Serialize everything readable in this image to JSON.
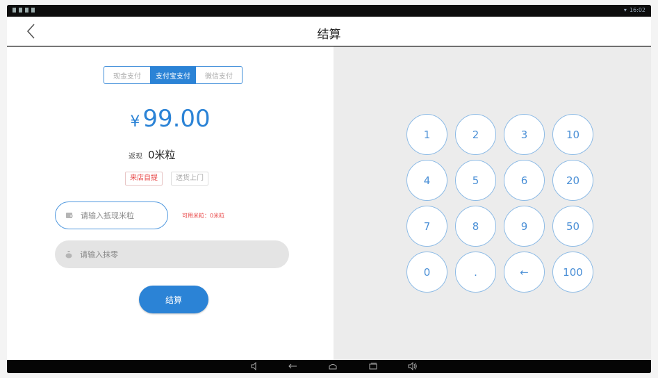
{
  "app": {
    "title": "结算"
  },
  "payment_tabs": [
    {
      "label": "现金支付",
      "active": false
    },
    {
      "label": "支付宝支付",
      "active": true
    },
    {
      "label": "微信支付",
      "active": false
    }
  ],
  "amount": {
    "currency": "¥",
    "value": "99.00"
  },
  "cashback": {
    "label": "返现",
    "value": "0米粒"
  },
  "delivery_options": [
    {
      "label": "来店自提",
      "active": true
    },
    {
      "label": "送货上门",
      "active": false
    }
  ],
  "points_input": {
    "placeholder": "请输入抵现米粒",
    "available": "可用米粒：0米粒"
  },
  "rounding_input": {
    "placeholder": "请输入抹零"
  },
  "checkout_button": {
    "label": "结算"
  },
  "keypad": {
    "keys": [
      "1",
      "2",
      "3",
      "10",
      "4",
      "5",
      "6",
      "20",
      "7",
      "8",
      "9",
      "50",
      "0",
      ".",
      "←",
      "100"
    ]
  },
  "status_bar": {
    "time": "16:02"
  },
  "colors": {
    "accent": "#2b83d6",
    "warning": "#e84747",
    "keypad_bg": "#ececec"
  }
}
